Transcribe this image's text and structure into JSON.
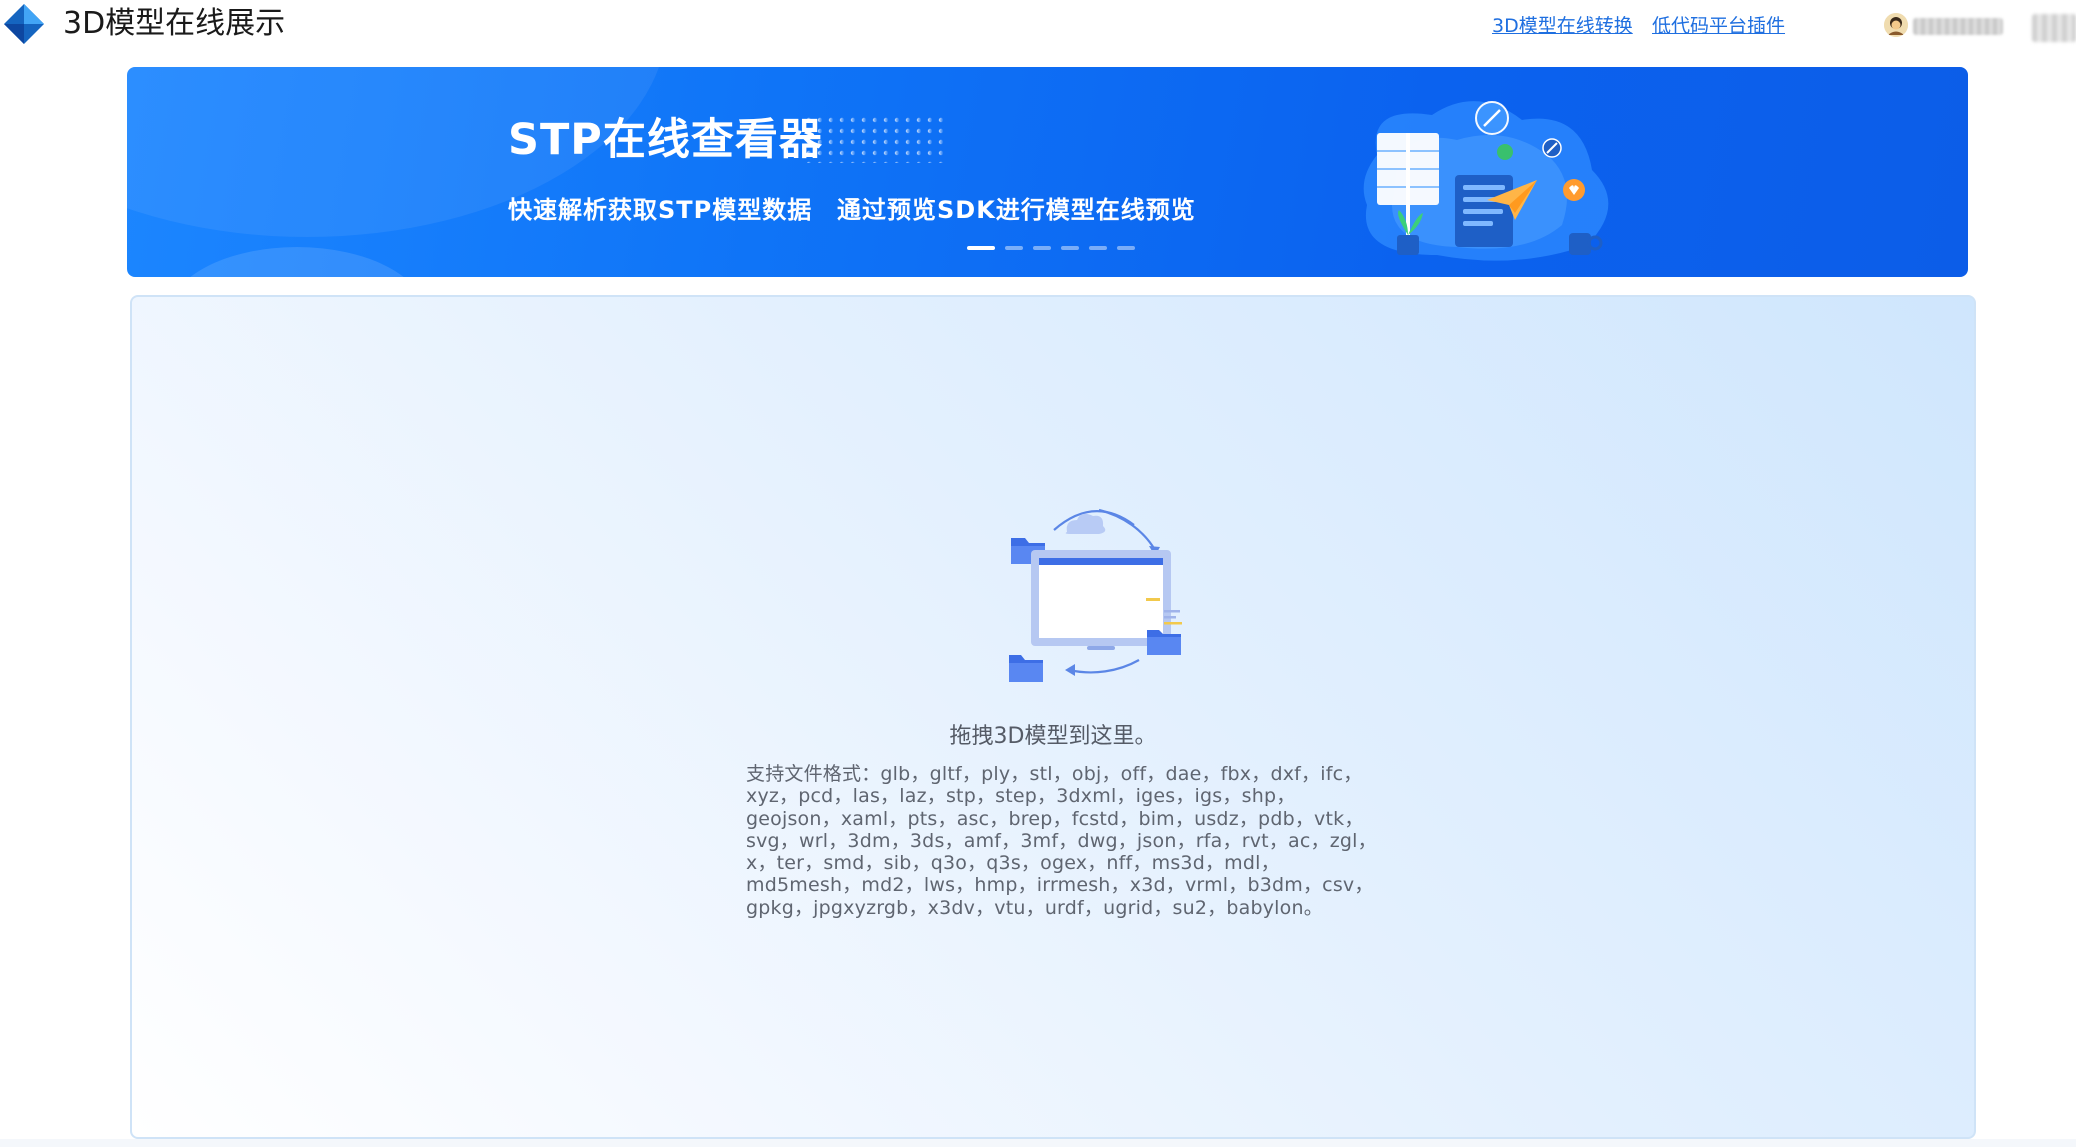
{
  "app": {
    "title": "3D模型在线展示"
  },
  "nav": {
    "convert_label": "3D模型在线转换",
    "plugin_label": "低代码平台插件"
  },
  "banner": {
    "title": "STP在线查看器",
    "subtitle_left": "快速解析获取STP模型数据",
    "subtitle_right": "通过预览SDK进行模型在线预览",
    "slide_count": 6,
    "active_slide": 1
  },
  "dropzone": {
    "title": "拖拽3D模型到这里。",
    "formats_prefix": "支持文件格式：",
    "formats": "glb，gltf，ply，stl，obj，off，dae，fbx，dxf，ifc，xyz，pcd，las，laz，stp，step，3dxml，iges，igs，shp，geojson，xaml，pts，asc，brep，fcstd，bim，usdz，pdb，vtk，svg，wrl，3dm，3ds，amf，3mf，dwg，json，rfa，rvt，ac，zgl，x，ter，smd，sib，q3o，q3s，ogex，nff，ms3d，mdl，md5mesh，md2，lws，hmp，irrmesh，x3d，vrml，b3dm，csv，gpkg，jpgxyzrgb，x3dv，vtu，urdf，ugrid，su2，babylon。"
  },
  "colors": {
    "accent": "#1f6fe0",
    "banner_blue": "#0f74f7",
    "logo_blue": "#1565c0"
  }
}
